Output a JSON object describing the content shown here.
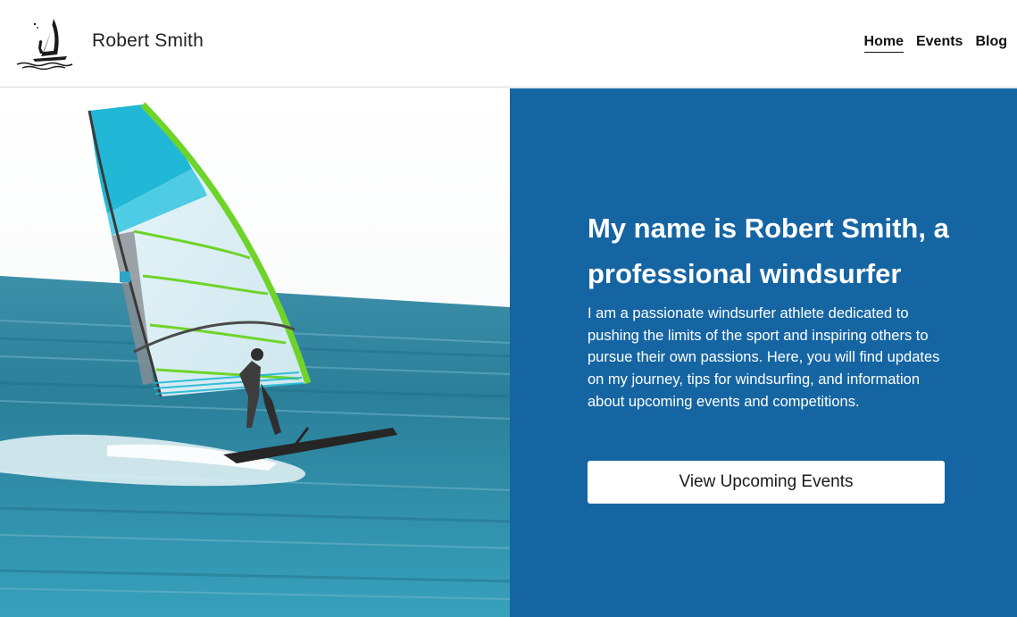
{
  "header": {
    "logo_icon": "windsurfer-logo-icon",
    "site_title": "Robert Smith",
    "nav": [
      {
        "label": "Home",
        "active": true
      },
      {
        "label": "Events",
        "active": false
      },
      {
        "label": "Blog",
        "active": false
      }
    ]
  },
  "hero": {
    "image_icon": "windsurfer-photo",
    "heading": "My name is Robert Smith, a professional windsurfer",
    "body": "I am a passionate windsurfer athlete dedicated to pushing the limits of the sport and inspiring others to pursue their own passions. Here, you will find updates on my journey, tips for windsurfing, and information about upcoming events and competitions.",
    "cta_label": "View Upcoming Events"
  },
  "colors": {
    "panel": "#1565a3",
    "sail_green": "#6fd42a",
    "sail_cyan": "#21b7d6",
    "water": "#2d86a0"
  }
}
